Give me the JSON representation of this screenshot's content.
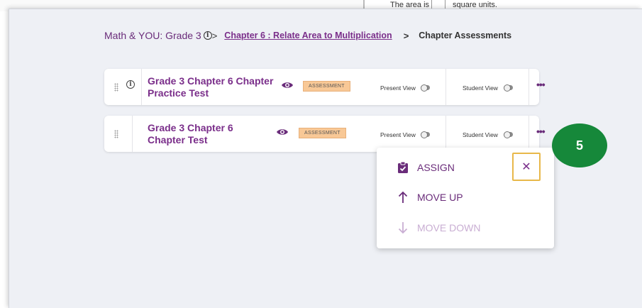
{
  "background_snippet": {
    "text_before": "The area is",
    "text_after": "square units."
  },
  "breadcrumb": {
    "root": "Math & YOU: Grade 3",
    "inline_sep": ">",
    "chapter_link": "Chapter 6 : Relate Area to Multiplication",
    "separator": ">",
    "current": "Chapter Assessments"
  },
  "rows": [
    {
      "title": "Grade 3 Chapter 6 Chapter Practice Test",
      "badge": "ASSESSMENT",
      "present_view_label": "Present View",
      "student_view_label": "Student View",
      "more": "•••"
    },
    {
      "title": "Grade 3 Chapter 6 Chapter Test",
      "badge": "ASSESSMENT",
      "present_view_label": "Present View",
      "student_view_label": "Student View",
      "more": "•••"
    }
  ],
  "menu": {
    "assign": "ASSIGN",
    "move_up": "MOVE UP",
    "move_down": "MOVE DOWN",
    "close": "✕"
  },
  "step_badge": "5",
  "colors": {
    "brand_purple": "#7a2e8a",
    "badge_orange": "#f8c896",
    "highlight_yellow": "#e8b84a",
    "step_green": "#16883a"
  }
}
